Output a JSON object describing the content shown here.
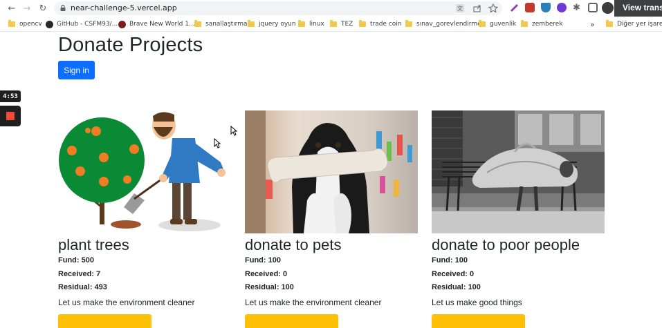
{
  "browser": {
    "url": "near-challenge-5.vercel.app",
    "tooltip": "View trans",
    "bookmarks": [
      {
        "label": "opencv",
        "kind": "folder"
      },
      {
        "label": "GitHub - CSFM93/...",
        "kind": "github"
      },
      {
        "label": "Brave New World 1...",
        "kind": "brave"
      },
      {
        "label": "sanallaştırma",
        "kind": "folder"
      },
      {
        "label": "jquery oyun",
        "kind": "folder"
      },
      {
        "label": "linux",
        "kind": "folder"
      },
      {
        "label": "TEZ",
        "kind": "folder"
      },
      {
        "label": "trade coin",
        "kind": "folder"
      },
      {
        "label": "sınav_gorevlendirme",
        "kind": "folder"
      },
      {
        "label": "guvenlik",
        "kind": "folder"
      },
      {
        "label": "zemberek",
        "kind": "folder"
      },
      {
        "label": "»",
        "kind": "overflow"
      },
      {
        "label": "Diğer yer işaretle",
        "kind": "folder"
      }
    ]
  },
  "recorder": {
    "time": "4:53"
  },
  "page": {
    "title": "Donate Projects",
    "sign_in_label": "Sign in"
  },
  "projects": [
    {
      "title": "plant trees",
      "fund": "Fund: 500",
      "received": "Received: 7",
      "residual": "Residual: 493",
      "description": "Let us make the environment cleaner",
      "image": "tree-planting-illustration"
    },
    {
      "title": "donate to pets",
      "fund": "Fund: 100",
      "received": "Received: 0",
      "residual": "Residual: 100",
      "description": "Let us make the environment cleaner",
      "image": "dog-with-bone-photo"
    },
    {
      "title": "donate to poor people",
      "fund": "Fund: 100",
      "received": "Received: 0",
      "residual": "Residual: 100",
      "description": "Let us make good things",
      "image": "person-on-bench-photo"
    }
  ],
  "colors": {
    "primary": "#0d6efd",
    "donate_button": "#ffc107",
    "text": "#212529"
  }
}
